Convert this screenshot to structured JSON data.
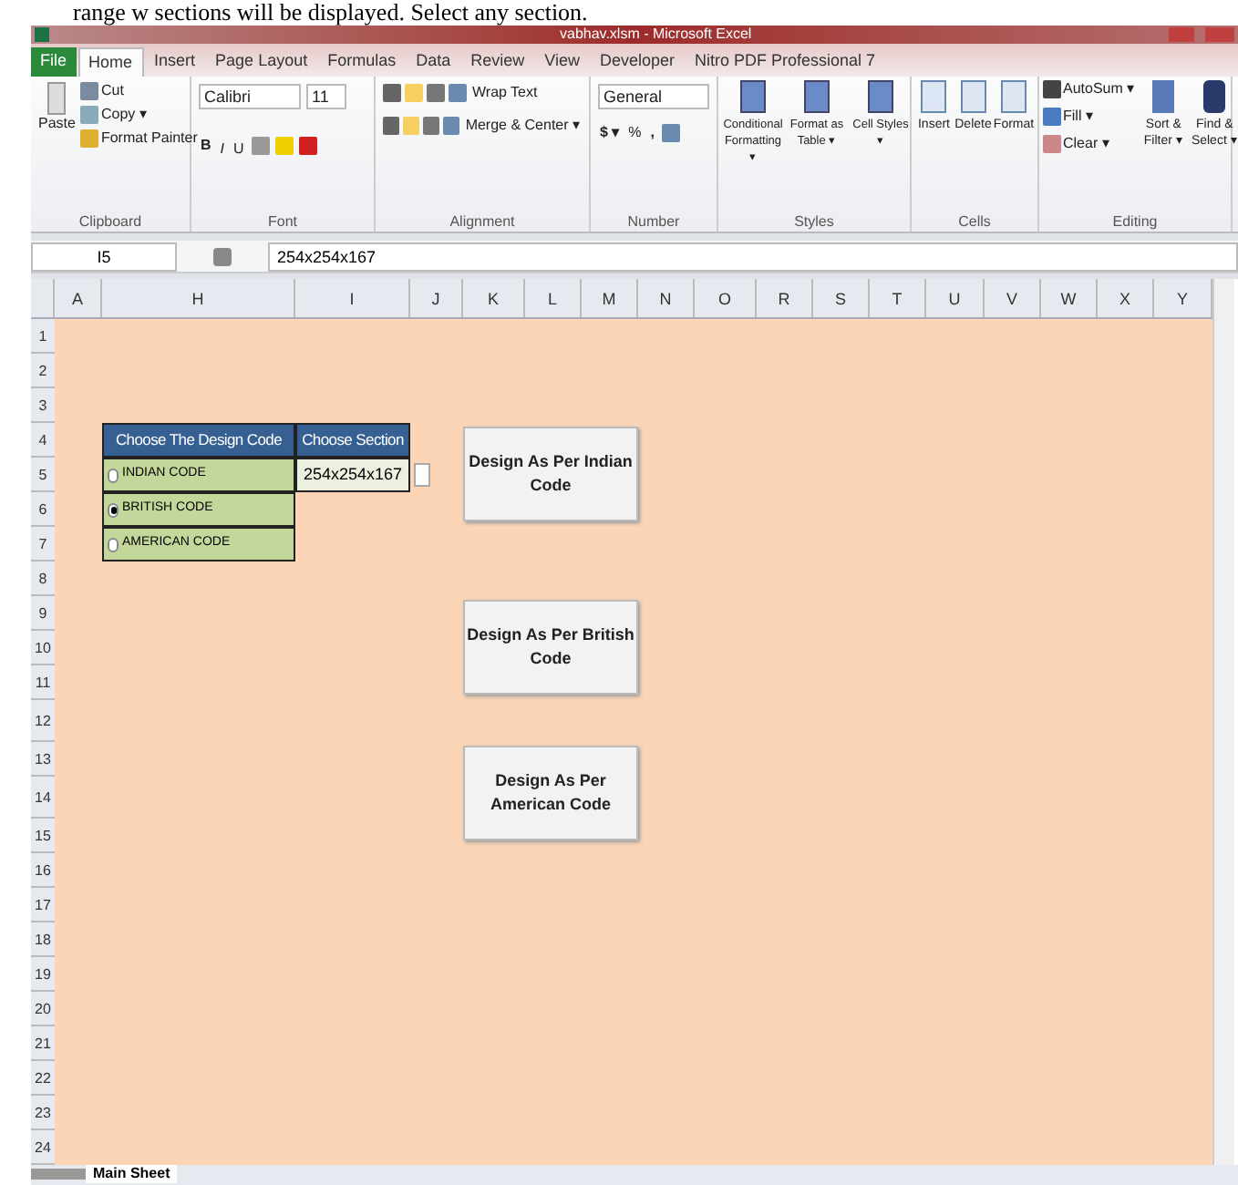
{
  "caption": "range w sections will be displayed. Select any section.",
  "window": {
    "title": "vabhav.xlsm - Microsoft Excel"
  },
  "ribbon_tabs": [
    {
      "label": "File",
      "selected": false,
      "kind": "file"
    },
    {
      "label": "Home",
      "selected": true,
      "kind": "tab"
    },
    {
      "label": "Insert",
      "selected": false,
      "kind": "tab"
    },
    {
      "label": "Page Layout",
      "selected": false,
      "kind": "tab"
    },
    {
      "label": "Formulas",
      "selected": false,
      "kind": "tab"
    },
    {
      "label": "Data",
      "selected": false,
      "kind": "tab"
    },
    {
      "label": "Review",
      "selected": false,
      "kind": "tab"
    },
    {
      "label": "View",
      "selected": false,
      "kind": "tab"
    },
    {
      "label": "Developer",
      "selected": false,
      "kind": "tab"
    },
    {
      "label": "Nitro PDF Professional 7",
      "selected": false,
      "kind": "tab"
    }
  ],
  "clipboard": {
    "paste": "Paste",
    "cut": "Cut",
    "copy": "Copy ▾",
    "format_painter": "Format Painter",
    "label": "Clipboard"
  },
  "font": {
    "name": "Calibri",
    "size": "11",
    "bold": "B",
    "italic": "I",
    "underline": "U",
    "label": "Font"
  },
  "alignment": {
    "wrap": "Wrap Text",
    "merge": "Merge & Center ▾",
    "label": "Alignment"
  },
  "number": {
    "format": "General",
    "currency": "$ ▾",
    "percent": "%",
    "comma": ",",
    "label": "Number"
  },
  "styles": {
    "items": [
      "Conditional Formatting ▾",
      "Format as Table ▾",
      "Cell Styles ▾"
    ],
    "label": "Styles"
  },
  "cells": {
    "items": [
      "Insert",
      "Delete",
      "Format"
    ],
    "label": "Cells"
  },
  "editing": {
    "autosum": "AutoSum ▾",
    "fill": "Fill ▾",
    "clear": "Clear ▾",
    "sort": "Sort & Filter ▾",
    "find": "Find & Select ▾",
    "label": "Editing"
  },
  "formula_bar": {
    "name_box": "I5",
    "formula": "254x254x167"
  },
  "columns": [
    "A",
    "H",
    "I",
    "J",
    "K",
    "L",
    "M",
    "N",
    "O",
    "R",
    "S",
    "T",
    "U",
    "V",
    "W",
    "X",
    "Y"
  ],
  "rows": [
    "1",
    "2",
    "3",
    "4",
    "5",
    "6",
    "7",
    "8",
    "9",
    "10",
    "11",
    "12",
    "13",
    "14",
    "15",
    "16",
    "17",
    "18",
    "19",
    "20",
    "21",
    "22",
    "23",
    "24"
  ],
  "design_table": {
    "header": [
      "Choose The Design Code",
      "Choose Section"
    ],
    "options": [
      {
        "label": "INDIAN CODE",
        "selected": false
      },
      {
        "label": "BRITISH CODE",
        "selected": true
      },
      {
        "label": "AMERICAN CODE",
        "selected": false
      }
    ],
    "section": "254x254x167"
  },
  "buttons": [
    "Design As Per Indian Code",
    "Design As Per British Code",
    "Design As Per American Code"
  ],
  "sheet_tabs": [
    {
      "label": "Main Sheet",
      "selected": true
    }
  ]
}
